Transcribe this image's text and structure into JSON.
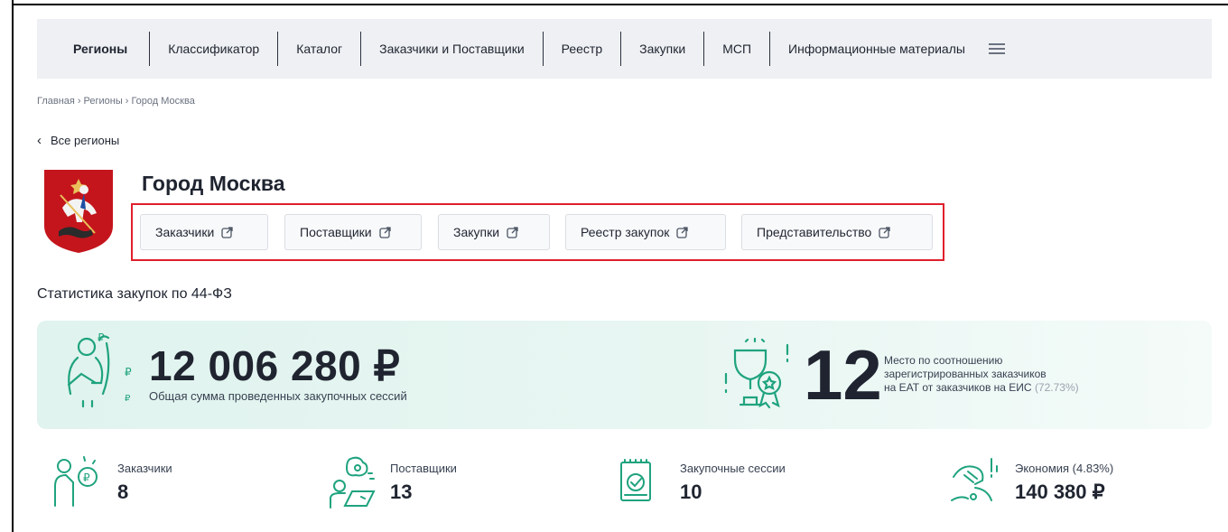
{
  "nav": {
    "items": [
      {
        "label": "Регионы"
      },
      {
        "label": "Классификатор"
      },
      {
        "label": "Каталог"
      },
      {
        "label": "Заказчики и Поставщики"
      },
      {
        "label": "Реестр"
      },
      {
        "label": "Закупки"
      },
      {
        "label": "МСП"
      },
      {
        "label": "Информационные материалы"
      }
    ]
  },
  "breadcrumb": [
    "Главная",
    "Регионы",
    "Город Москва"
  ],
  "back_link": "Все регионы",
  "region": {
    "title": "Город Москва",
    "buttons": [
      {
        "label": "Заказчики"
      },
      {
        "label": "Поставщики"
      },
      {
        "label": "Закупки"
      },
      {
        "label": "Реестр закупок"
      },
      {
        "label": "Представительство"
      }
    ]
  },
  "stats": {
    "title": "Статистика закупок по 44-ФЗ",
    "total_sum": "12 006 280 ₽",
    "total_sum_caption": "Общая сумма проведенных закупочных сессий",
    "place": "12",
    "place_desc_line1": "Место по соотношению",
    "place_desc_line2": "зарегистрированных заказчиков",
    "place_desc_line3": "на ЕАТ от заказчиков на ЕИС",
    "place_pct": "(72.73%)",
    "metrics": [
      {
        "label": "Заказчики",
        "value": "8"
      },
      {
        "label": "Поставщики",
        "value": "13"
      },
      {
        "label": "Закупочные сессии",
        "value": "10"
      },
      {
        "label": "Экономия (4.83%)",
        "value": "140 380 ₽"
      }
    ]
  },
  "colors": {
    "accent_green": "#1fa37e",
    "highlight_red": "#e0202c",
    "banner_bg": "#e0f3ee",
    "nav_bg": "#eef0f3"
  }
}
